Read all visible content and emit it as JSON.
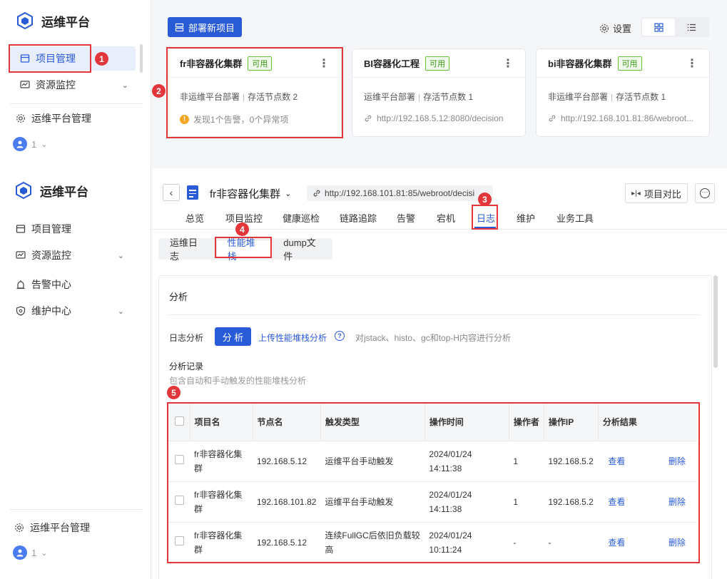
{
  "app": {
    "title": "运维平台"
  },
  "top": {
    "sidebar": {
      "items": [
        {
          "label": "项目管理"
        },
        {
          "label": "资源监控"
        }
      ],
      "footer": "运维平台管理",
      "user": "1"
    },
    "deploy_button": "部署新项目",
    "settings": "设置",
    "cards": [
      {
        "title": "fr非容器化集群",
        "tag": "可用",
        "line1a": "非运维平台部署",
        "line1b": "存活节点数 2",
        "line2": "发现1个告警，0个异常项",
        "line2_icon": "warning-icon"
      },
      {
        "title": "BI容器化工程",
        "tag": "可用",
        "line1a": "运维平台部署",
        "line1b": "存活节点数 1",
        "line2": "http://192.168.5.12:8080/decision",
        "line2_icon": "link-icon"
      },
      {
        "title": "bi非容器化集群",
        "tag": "可用",
        "line1a": "非运维平台部署",
        "line1b": "存活节点数 1",
        "line2": "http://192.168.101.81:86/webroot...",
        "line2_icon": "link-icon"
      }
    ]
  },
  "bottom": {
    "sidebar": {
      "items": [
        {
          "label": "项目管理"
        },
        {
          "label": "资源监控"
        },
        {
          "label": "告警中心"
        },
        {
          "label": "维护中心"
        }
      ],
      "footer": "运维平台管理",
      "user": "1"
    },
    "project": {
      "name": "fr非容器化集群",
      "url": "http://192.168.101.81:85/webroot/decisi"
    },
    "compare_button": "项目对比",
    "tabs": [
      "总览",
      "项目监控",
      "健康巡检",
      "链路追踪",
      "告警",
      "宕机",
      "日志",
      "维护",
      "业务工具"
    ],
    "subtabs": [
      "运维日志",
      "性能堆栈",
      "dump文件"
    ],
    "section_title": "分析",
    "log_label": "日志分析",
    "analyze_button": "分 析",
    "upload_link": "上传性能堆栈分析",
    "hint": "对jstack、histo、gc和top-H内容进行分析",
    "records_title": "分析记录",
    "records_desc": "包含自动和手动触发的性能堆栈分析",
    "table": {
      "headers": [
        "项目名",
        "节点名",
        "触发类型",
        "操作时间",
        "操作者",
        "操作IP",
        "分析结果"
      ],
      "rows": [
        {
          "project": "fr非容器化集群",
          "node": "192.168.5.12",
          "trigger": "运维平台手动触发",
          "date": "2024/01/24",
          "time": "14:11:38",
          "operator": "1",
          "ip": "192.168.5.2",
          "view": "查看",
          "del": "删除"
        },
        {
          "project": "fr非容器化集群",
          "node": "192.168.101.82",
          "trigger": "运维平台手动触发",
          "date": "2024/01/24",
          "time": "14:11:38",
          "operator": "1",
          "ip": "192.168.5.2",
          "view": "查看",
          "del": "删除"
        },
        {
          "project": "fr非容器化集群",
          "node": "192.168.5.12",
          "trigger": "连续FullGC后依旧负载较高",
          "date": "2024/01/24",
          "time": "10:11:24",
          "operator": "-",
          "ip": "-",
          "view": "查看",
          "del": "删除"
        }
      ]
    }
  },
  "badges": [
    "1",
    "2",
    "3",
    "4",
    "5"
  ],
  "colors": {
    "accent": "#2a5bd7",
    "annotation": "#e2363a",
    "success": "#67c23a",
    "warning": "#f5a623"
  }
}
